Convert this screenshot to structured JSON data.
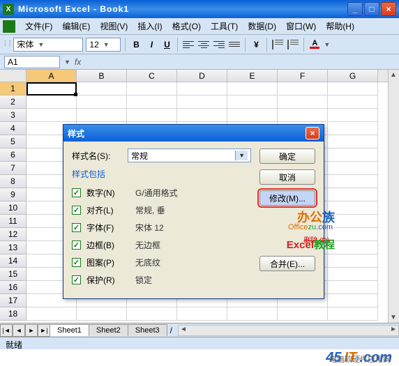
{
  "titlebar": {
    "text": "Microsoft Excel - Book1"
  },
  "menu": {
    "file": "文件(F)",
    "edit": "编辑(E)",
    "view": "视图(V)",
    "insert": "插入(I)",
    "format": "格式(O)",
    "tools": "工具(T)",
    "data": "数据(D)",
    "window": "窗口(W)",
    "help": "帮助(H)"
  },
  "toolbar": {
    "font_name": "宋体",
    "font_size": "12"
  },
  "formula": {
    "cell_ref": "A1",
    "fx": "fx"
  },
  "columns": [
    "A",
    "B",
    "C",
    "D",
    "E",
    "F",
    "G"
  ],
  "rows": [
    "1",
    "2",
    "3",
    "4",
    "5",
    "6",
    "7",
    "8",
    "9",
    "10",
    "11",
    "12",
    "13",
    "14",
    "15",
    "16",
    "17",
    "18"
  ],
  "sheets": {
    "s1": "Sheet1",
    "s2": "Sheet2",
    "s3": "Sheet3"
  },
  "status": "就绪",
  "dialog": {
    "title": "样式",
    "style_name_label": "样式名(S):",
    "style_name_value": "常规",
    "includes_label": "样式包括",
    "items": {
      "number": {
        "label": "数字(N)",
        "value": "G/通用格式"
      },
      "align": {
        "label": "对齐(L)",
        "value": "常规, 垂"
      },
      "font": {
        "label": "字体(F)",
        "value": "宋体 12"
      },
      "border": {
        "label": "边框(B)",
        "value": "无边框"
      },
      "pattern": {
        "label": "图案(P)",
        "value": "无底纹"
      },
      "protect": {
        "label": "保护(R)",
        "value": "锁定"
      }
    },
    "buttons": {
      "ok": "确定",
      "cancel": "取消",
      "modify": "修改(M)...",
      "merge": "合并(E)..."
    },
    "strike": "删除 (D)"
  },
  "watermark": {
    "bgz": "办公族",
    "officezu": "Officezu.com",
    "excel": "Excel教程",
    "logo": "45IT.com",
    "logo_sub": "电脑软硬件应用网"
  }
}
